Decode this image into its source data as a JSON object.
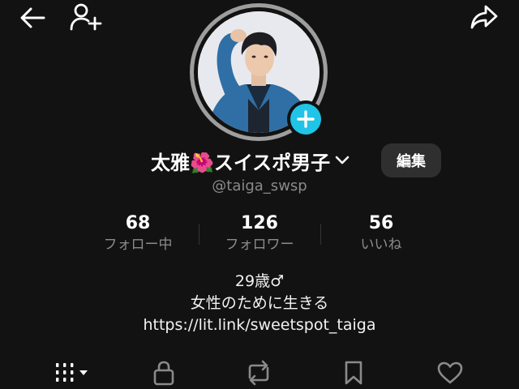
{
  "header": {
    "back_icon": "arrow-left-icon",
    "add_friend_icon": "person-plus-icon",
    "share_icon": "share-arrow-icon"
  },
  "profile": {
    "display_name": "太雅🌺スイスポ男子",
    "username": "@taiga_swsp",
    "edit_label": "編集",
    "avatar_badge_icon": "plus-icon",
    "accent_color": "#20c4e6"
  },
  "stats": [
    {
      "value": "68",
      "label": "フォロー中"
    },
    {
      "value": "126",
      "label": "フォロワー"
    },
    {
      "value": "56",
      "label": "いいね"
    }
  ],
  "bio": {
    "line1": "29歳♂",
    "line2": "女性のために生きる",
    "link": "https://lit.link/sweetspot_taiga"
  },
  "tabs": [
    {
      "icon": "grid-dropdown-icon"
    },
    {
      "icon": "lock-icon"
    },
    {
      "icon": "repost-icon"
    },
    {
      "icon": "bookmark-icon"
    },
    {
      "icon": "heart-icon"
    }
  ]
}
